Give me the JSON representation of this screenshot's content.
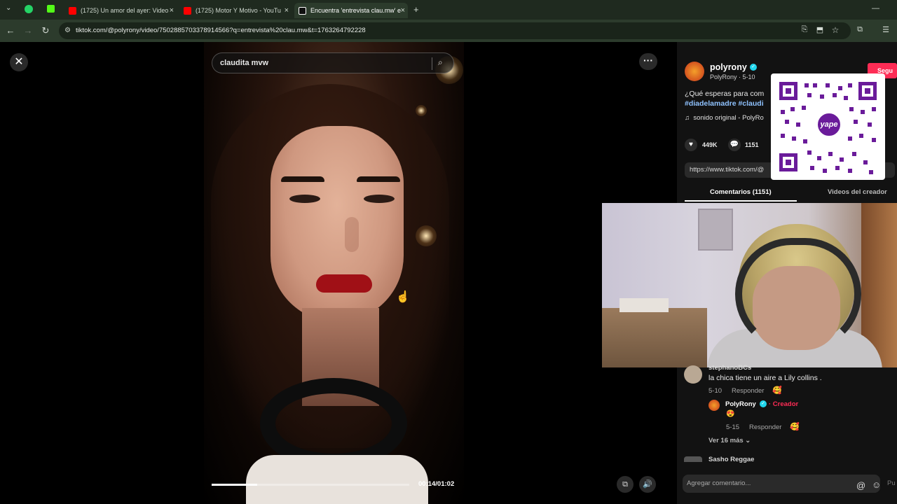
{
  "browser": {
    "tabs": [
      {
        "label": "(1725) Un amor del ayer: Video",
        "fav_color": "#ff0000"
      },
      {
        "label": "(1725) Motor Y Motivo - YouTu",
        "fav_color": "#ff0000"
      },
      {
        "label": "Encuentra 'entrevista clau.mw' e",
        "fav_color": "#111111"
      }
    ],
    "url": "tiktok.com/@polyrony/video/7502885703378914566?q=entrevista%20clau.mw&t=1763264792228"
  },
  "video": {
    "search_query": "claudita mvw",
    "time": "00:14/01:02",
    "progress": 0.23
  },
  "post": {
    "author": "polyrony",
    "author_meta": "PolyRony · 5-10",
    "follow_label": "Segu",
    "description": "¿Qué esperas para com",
    "hashtags": "#diadelamadre #claudi",
    "sound": "sonido original - PolyRo",
    "likes": "449K",
    "comments": "1151",
    "link": "https://www.tiktok.com/@",
    "tab_comments": "Comentarios (1151)",
    "tab_creator": "Videos del creador"
  },
  "qr": {
    "brand": "yape"
  },
  "comments": [
    {
      "user": "stephanoBCs",
      "text": "la chica tiene un aire a Lily collins .",
      "date": "5-10",
      "reply": "Responder"
    },
    {
      "user": "PolyRony",
      "creator_tag": "· Creador",
      "text": "😍",
      "date": "5-15",
      "reply": "Responder"
    }
  ],
  "view_more": "Ver 16 más ⌄",
  "next_comment_user": "Sasho Reggae",
  "comment_input_placeholder": "Agregar comentario...",
  "post_label": "Pu",
  "colors": {
    "accent": "#fe2c55",
    "verified": "#20d5ec",
    "hashtag": "#8fc2ff",
    "qr_purple": "#6a1b9a"
  }
}
